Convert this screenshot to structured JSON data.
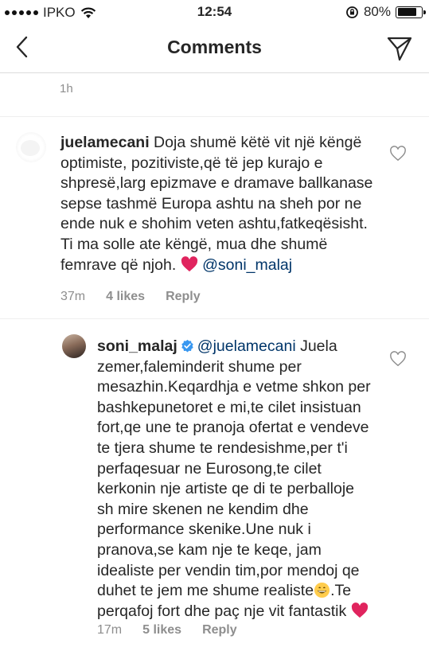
{
  "status_bar": {
    "carrier": "IPKO",
    "time": "12:54",
    "battery": "80%",
    "battery_level": 0.8
  },
  "nav": {
    "title": "Comments"
  },
  "previous_comment": {
    "time": "1h"
  },
  "comments": [
    {
      "username": "juelamecani",
      "text": " Doja shumë këtë vit një këngë optimiste, pozitiviste,që të jep kurajo e shpresë,larg epizmave e dramave ballkanase sepse tashmë Europa ashtu na sheh por ne ende nuk e shohim veten ashtu,fatkeqësisht. Ti ma solle ate këngë, mua dhe shumë femrave që njoh. ",
      "mention": "@soni_malaj",
      "time": "37m",
      "likes": "4 likes",
      "reply": "Reply"
    },
    {
      "username": "soni_malaj",
      "mention": "@juelamecani",
      "text_a": " Juela zemer,faleminderit shume per mesazhin.Keqardhja e vetme shkon per bashkepunetoret e mi,te cilet insistuan fort,qe une te pranoja ofertat e vendeve te tjera shume te rendesishme,per t'i perfaqesuar ne Eurosong,te cilet kerkonin nje artiste qe di te perballoje sh mire skenen ne kendim dhe performance skenike.Une nuk i pranova,se kam nje te keqe, jam idealiste per vendin tim,por mendoj qe duhet te jem me shume realiste",
      "text_b": ".Te perqafoj fort dhe paç nje vit fantastik ",
      "time": "17m",
      "likes": "5 likes",
      "reply": "Reply"
    }
  ],
  "colors": {
    "mention": "#003569",
    "meta": "#8e8e8e",
    "verified": "#3897f0",
    "heart": "#ed4956"
  }
}
